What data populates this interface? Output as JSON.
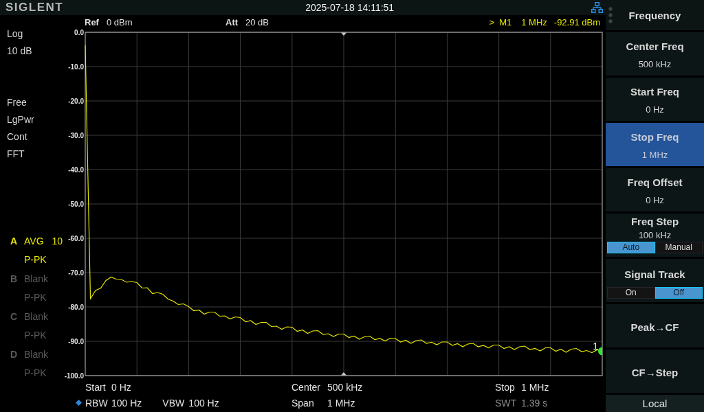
{
  "top_bar": {
    "logo": "SIGLENT",
    "datetime": "2025-07-18 14:11:51"
  },
  "header": {
    "fields": [
      {
        "label": "Ref",
        "value": "0 dBm"
      },
      {
        "label": "Att",
        "value": "20 dB"
      }
    ],
    "marker_readout": {
      "pointer": ">",
      "name": "M1",
      "frequency": "1 MHz",
      "amplitude": "-92.91 dBm"
    }
  },
  "left_info": {
    "scale": [
      "Log",
      "10 dB"
    ],
    "modes": [
      "Free",
      "LgPwr",
      "Cont",
      "FFT"
    ],
    "traces": [
      {
        "letter": "A",
        "mode": "AVG",
        "count": "10",
        "detector": "P-PK",
        "active": true
      },
      {
        "letter": "B",
        "mode": "Blank",
        "detector": "P-PK",
        "active": false
      },
      {
        "letter": "C",
        "mode": "Blank",
        "detector": "P-PK",
        "active": false
      },
      {
        "letter": "D",
        "mode": "Blank",
        "detector": "P-PK",
        "active": false
      }
    ]
  },
  "display": {
    "chart_data": {
      "type": "line",
      "grid": true,
      "ylim": [
        -100,
        0
      ],
      "yticks": [
        {
          "value": 0,
          "label": "0.0"
        },
        {
          "value": -10,
          "label": "-10.0"
        },
        {
          "value": -20,
          "label": "-20.0"
        },
        {
          "value": -30,
          "label": "-30.0"
        },
        {
          "value": -40,
          "label": "-40.0"
        },
        {
          "value": -50,
          "label": "-50.0"
        },
        {
          "value": -60,
          "label": "-60.0"
        },
        {
          "value": -70,
          "label": "-70.0"
        },
        {
          "value": -80,
          "label": "-80.0"
        },
        {
          "value": -90,
          "label": "-90.0"
        },
        {
          "value": -100,
          "label": "-100.0"
        }
      ],
      "series": [
        {
          "color": "#e6e600",
          "values": [
            -3.8,
            -77.6,
            -75.2,
            -74.5,
            -72.3,
            -71.3,
            -71.9,
            -72.0,
            -72.8,
            -72.6,
            -72.9,
            -74.5,
            -74.4,
            -76.1,
            -75.8,
            -76.3,
            -77.7,
            -78.3,
            -79.3,
            -79.1,
            -79.9,
            -81.1,
            -80.9,
            -82.1,
            -81.5,
            -81.5,
            -82.7,
            -82.6,
            -83.5,
            -82.9,
            -83.1,
            -84.3,
            -84.0,
            -85.1,
            -84.5,
            -84.5,
            -85.7,
            -85.6,
            -86.5,
            -85.8,
            -85.9,
            -87.1,
            -86.7,
            -87.7,
            -87.0,
            -86.9,
            -88.0,
            -87.8,
            -88.6,
            -87.9,
            -87.9,
            -88.9,
            -88.5,
            -89.4,
            -88.7,
            -88.5,
            -89.5,
            -89.2,
            -89.9,
            -89.1,
            -89.2,
            -90.2,
            -89.7,
            -90.6,
            -89.8,
            -89.6,
            -90.6,
            -90.3,
            -91.0,
            -90.2,
            -90.2,
            -91.2,
            -90.7,
            -91.6,
            -90.8,
            -90.6,
            -91.6,
            -91.2,
            -91.9,
            -91.1,
            -91.1,
            -92.1,
            -91.6,
            -92.4,
            -91.6,
            -91.4,
            -92.4,
            -92.1,
            -92.8,
            -91.9,
            -91.9,
            -92.9,
            -92.3,
            -93.2,
            -92.3,
            -92.1,
            -93.0,
            -92.7,
            -93.3,
            -92.5,
            -92.9
          ]
        }
      ],
      "annotations": [
        "1"
      ]
    }
  },
  "footer_rows": [
    {
      "cells": [
        {
          "items": [
            {
              "label": "Start",
              "value": "0 Hz",
              "marked": false,
              "dimmed": false
            }
          ]
        },
        {
          "items": [
            {
              "label": "Center",
              "value": "500 kHz",
              "marked": false,
              "dimmed": false
            }
          ]
        },
        {
          "items": [
            {
              "label": "Stop",
              "value": "1 MHz",
              "marked": false,
              "dimmed": false
            }
          ]
        }
      ]
    },
    {
      "cells": [
        {
          "items": [
            {
              "label": "RBW",
              "value": "100 Hz",
              "marked": true,
              "dimmed": false
            },
            {
              "label": "VBW",
              "value": "100 Hz",
              "marked": false,
              "dimmed": false
            }
          ]
        },
        {
          "items": [
            {
              "label": "Span",
              "value": "1 MHz",
              "marked": false,
              "dimmed": false
            }
          ]
        },
        {
          "items": [
            {
              "label": "SWT",
              "value": "1.39 s",
              "marked": false,
              "dimmed": true
            }
          ]
        }
      ]
    }
  ],
  "panel": {
    "title": "Frequency",
    "softkeys": [
      {
        "kind": "value",
        "label": "Center Freq",
        "value": "500 kHz",
        "selected": false
      },
      {
        "kind": "value",
        "label": "Start Freq",
        "value": "0 Hz",
        "selected": false
      },
      {
        "kind": "value",
        "label": "Stop Freq",
        "value": "1 MHz",
        "selected": true
      },
      {
        "kind": "value",
        "label": "Freq Offset",
        "value": "0 Hz",
        "selected": false
      },
      {
        "kind": "toggle",
        "label": "Freq Step",
        "value": "100 kHz",
        "selected": false,
        "options": [
          {
            "label": "Auto",
            "selected": true
          },
          {
            "label": "Manual",
            "selected": false
          }
        ]
      },
      {
        "kind": "toggle",
        "label": "Signal Track",
        "selected": false,
        "options": [
          {
            "label": "On",
            "selected": false
          },
          {
            "label": "Off",
            "selected": true
          }
        ]
      },
      {
        "kind": "action",
        "label": "Peak→CF",
        "selected": false
      },
      {
        "kind": "action",
        "label": "CF→Step",
        "selected": false
      }
    ],
    "footer": "Local"
  }
}
